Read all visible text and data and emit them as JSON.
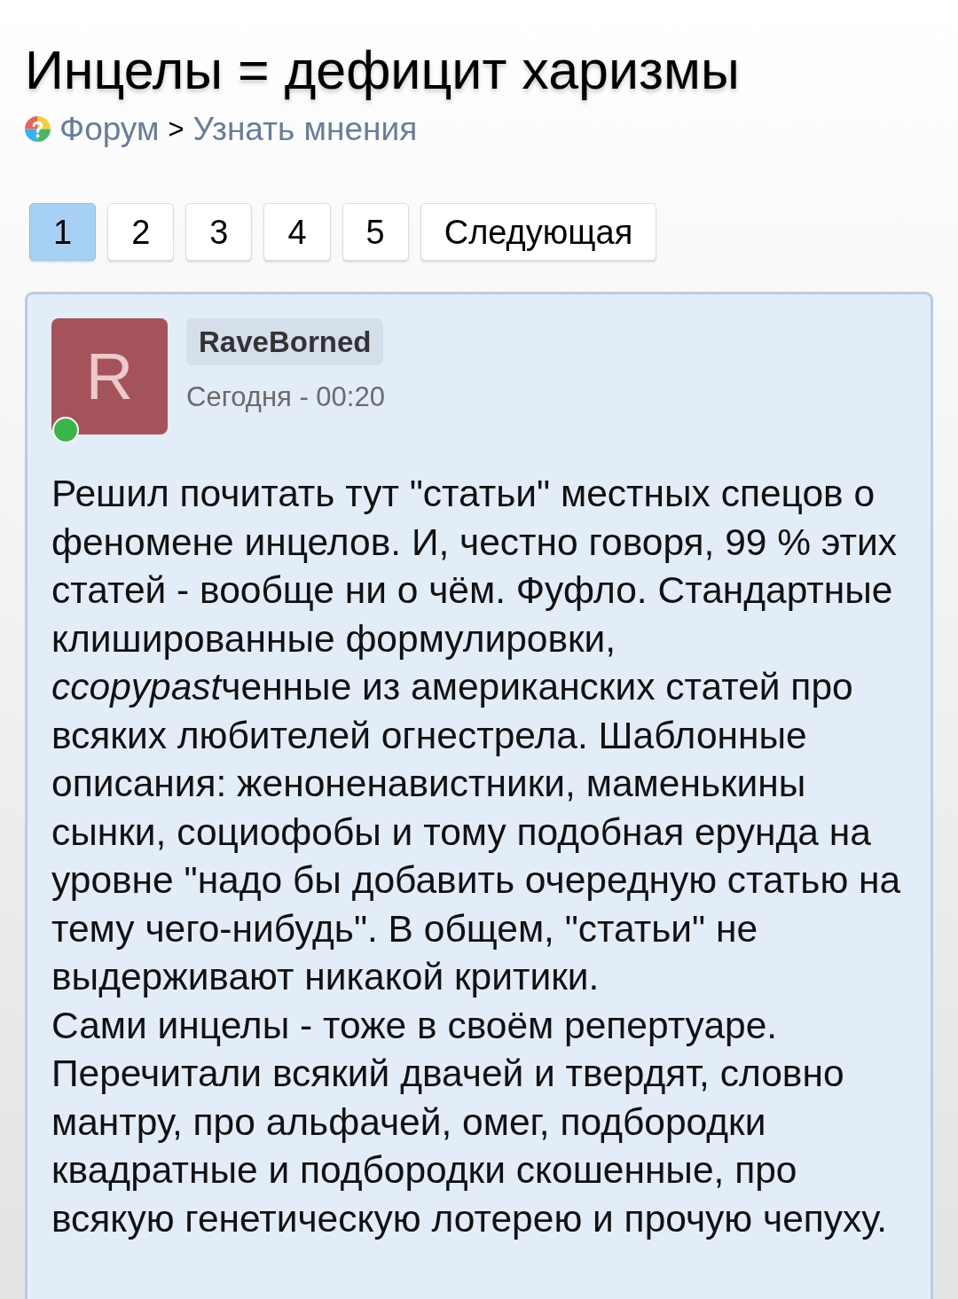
{
  "page": {
    "title": "Инцелы = дефицит харизмы"
  },
  "breadcrumb": {
    "separator": ">",
    "items": [
      {
        "label": "Форум"
      },
      {
        "label": "Узнать мнения"
      }
    ]
  },
  "pagination": [
    {
      "label": "1",
      "selected": true
    },
    {
      "label": "2",
      "selected": false
    },
    {
      "label": "3",
      "selected": false
    },
    {
      "label": "4",
      "selected": false
    },
    {
      "label": "5",
      "selected": false
    },
    {
      "label": "Следующая",
      "selected": false
    }
  ],
  "post": {
    "author": {
      "initial": "R",
      "name": "RaveBorned",
      "online": true
    },
    "date": "Сегодня - 00:20",
    "paragraphs": [
      {
        "runs": [
          {
            "text": "Решил почитать тут \"статьи\" местных спецов о феномене инцелов. И, честно говоря, 99 % этих статей - вообще ни о чём. Фуфло. Стандартные клишированные формулировки, ",
            "italic": false
          },
          {
            "text": "ccopypast",
            "italic": true
          },
          {
            "text": "ченные из американских статей про всяких любителей огнестрела. Шаблонные описания: женоненавистники, маменькины сынки, социофобы и тому подобная ерунда на уровне \"надо бы добавить очередную статью на тему чего-нибудь\". В общем, \"статьи\" не выдерживают никакой критики.",
            "italic": false
          }
        ]
      },
      {
        "runs": [
          {
            "text": "Сами инцелы - тоже в своём репертуаре. Перечитали всякий двачей и твердят, словно мантру, про альфачей, омег, подбородки квадратные и подбородки скошенные, про всякую генетическую лотерею и прочую чепуху.",
            "italic": false
          }
        ]
      }
    ]
  }
}
